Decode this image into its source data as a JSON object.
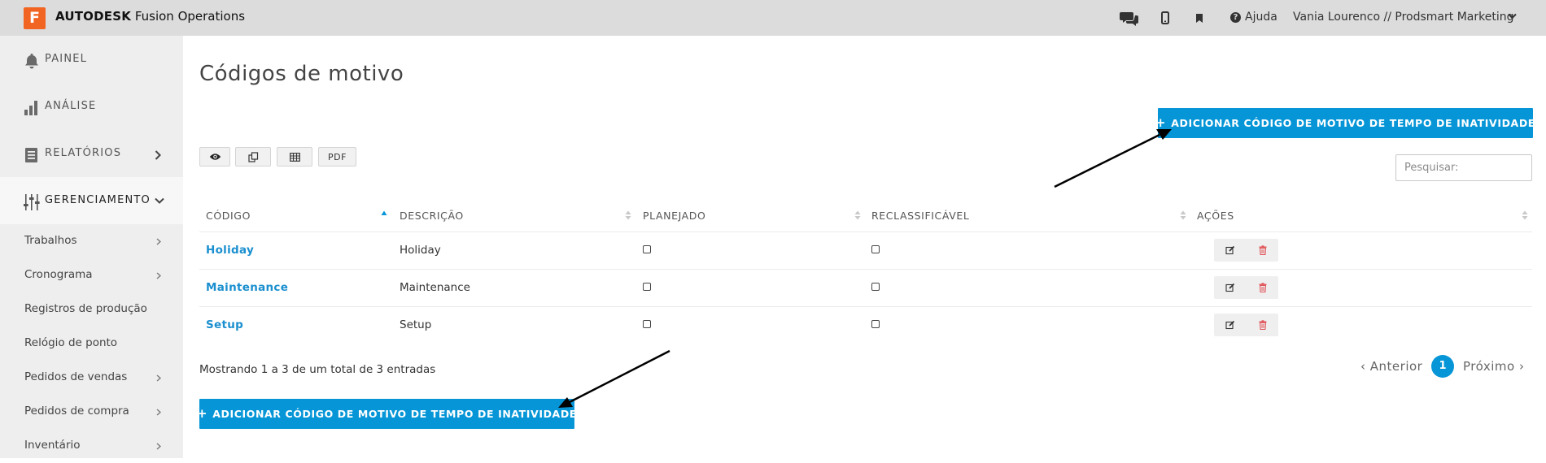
{
  "header": {
    "logo_letter": "F",
    "brand_bold": "AUTODESK",
    "brand_rest": "Fusion Operations",
    "help_label": "Ajuda",
    "user_label": "Vania Lourenco // Prodsmart Marketing"
  },
  "sidebar": {
    "main_items": [
      {
        "label": "PAINEL",
        "icon": "bell-icon"
      },
      {
        "label": "ANÁLISE",
        "icon": "bar-chart-icon"
      },
      {
        "label": "RELATÓRIOS",
        "icon": "document-icon"
      },
      {
        "label": "GERENCIAMENTO",
        "icon": "sliders-icon"
      }
    ],
    "sub_items": [
      {
        "label": "Trabalhos"
      },
      {
        "label": "Cronograma"
      },
      {
        "label": "Registros de produção"
      },
      {
        "label": "Relógio de ponto"
      },
      {
        "label": "Pedidos de vendas"
      },
      {
        "label": "Pedidos de compra"
      },
      {
        "label": "Inventário"
      }
    ]
  },
  "main": {
    "title": "Códigos de motivo",
    "add_button_label": "ADICIONAR CÓDIGO DE MOTIVO DE TEMPO DE INATIVIDADE",
    "toolbar": {
      "pdf_label": "PDF"
    },
    "search": {
      "placeholder": "Pesquisar:"
    },
    "table": {
      "columns": [
        "CÓDIGO",
        "DESCRIÇÃO",
        "PLANEJADO",
        "RECLASSIFICÁVEL",
        "AÇÕES"
      ],
      "rows": [
        {
          "code": "Holiday",
          "description": "Holiday",
          "planned": false,
          "reclassifiable": false
        },
        {
          "code": "Maintenance",
          "description": "Maintenance",
          "planned": false,
          "reclassifiable": false
        },
        {
          "code": "Setup",
          "description": "Setup",
          "planned": false,
          "reclassifiable": false
        }
      ]
    },
    "info_text": "Mostrando 1 a 3 de um total de 3 entradas",
    "pagination": {
      "prev_label": "Anterior",
      "current_page": "1",
      "next_label": "Próximo"
    }
  },
  "colors": {
    "accent": "#0696d7",
    "logo": "#f26422",
    "delete": "#e0555a"
  }
}
